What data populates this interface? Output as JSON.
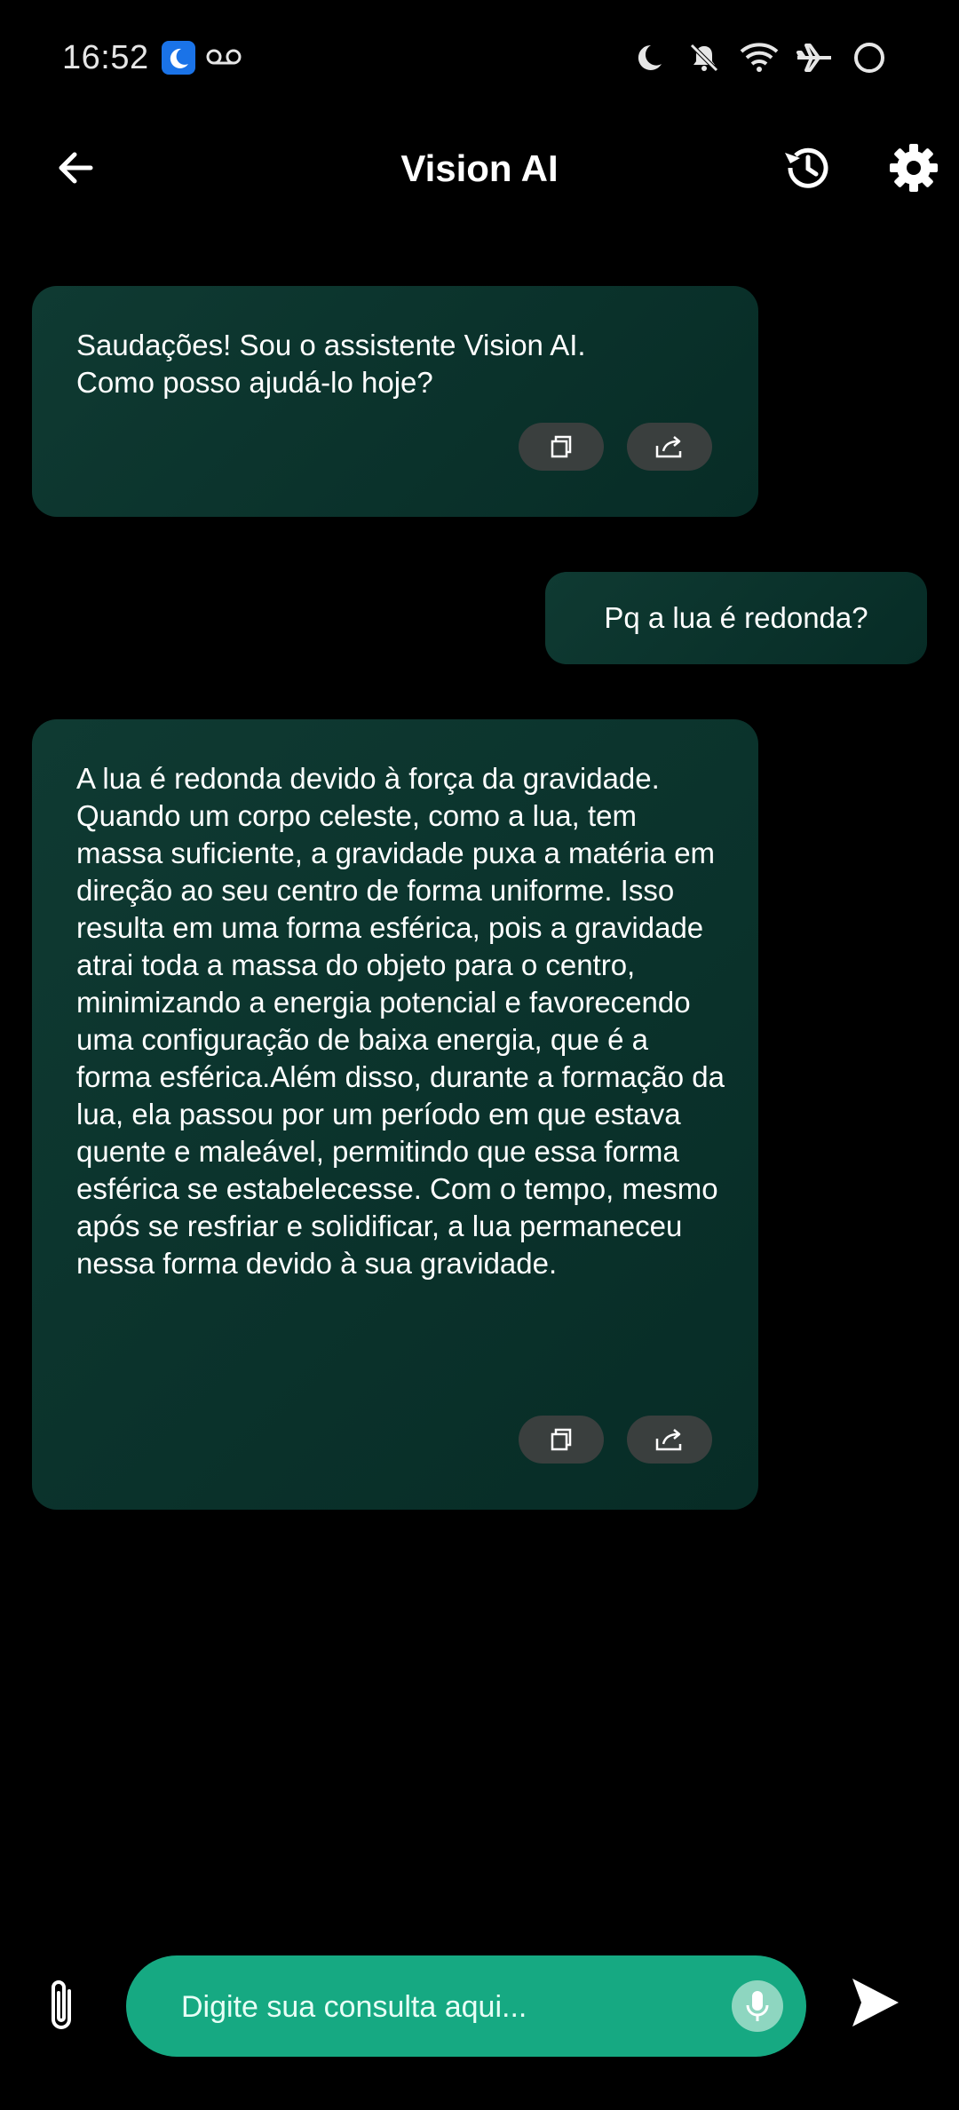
{
  "status_bar": {
    "time": "16:52",
    "icons": [
      "do-not-disturb-icon",
      "voicemail-icon",
      "moon-icon",
      "bell-off-icon",
      "wifi-icon",
      "airplane-icon",
      "battery-ring-icon"
    ]
  },
  "app_bar": {
    "title": "Vision AI",
    "icons": [
      "back-arrow-icon",
      "history-icon",
      "gear-icon"
    ]
  },
  "messages": [
    {
      "role": "assistant",
      "text": "Saudações! Sou o assistente Vision AI. Como posso ajudá-lo hoje?",
      "actions": [
        "copy-icon",
        "share-icon"
      ]
    },
    {
      "role": "user",
      "text": "Pq a lua é redonda?"
    },
    {
      "role": "assistant",
      "text": "A lua é redonda devido à força da gravidade. Quando um corpo celeste, como a lua, tem massa suficiente, a gravidade puxa a matéria em direção ao seu centro de forma uniforme. Isso resulta em uma forma esférica, pois a gravidade atrai toda a massa do objeto para o centro, minimizando a energia potencial e favorecendo uma configuração de baixa energia, que é a forma esférica.Além disso, durante a formação da lua, ela passou por um período em que estava quente e maleável, permitindo que essa forma esférica se estabelecesse. Com o tempo, mesmo após se resfriar e solidificar, a lua permaneceu nessa forma devido à sua gravidade.",
      "actions": [
        "copy-icon",
        "share-icon"
      ]
    }
  ],
  "input": {
    "placeholder": "Digite sua consulta aqui...",
    "value": ""
  },
  "colors": {
    "background": "#000000",
    "bubble": "#0b332c",
    "input_pill": "#16a982",
    "mic_bg": "#8ed6c0",
    "action_pill": "#3a3f3e"
  }
}
